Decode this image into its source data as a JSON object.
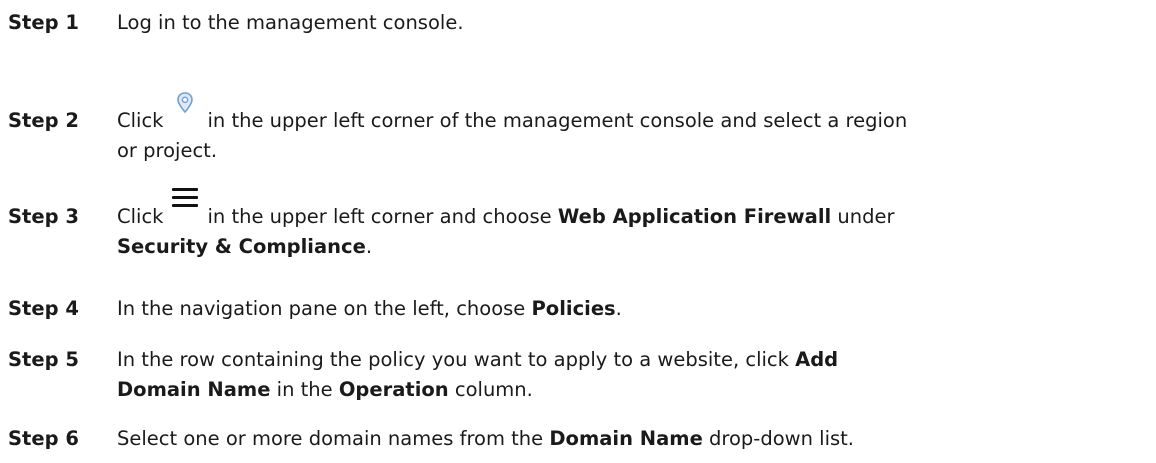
{
  "steps": [
    {
      "label": "Step 1",
      "parts": [
        "Log in to the management console."
      ]
    },
    {
      "label": "Step 2",
      "parts": [
        "Click",
        "in the upper left corner of the management console and select a region",
        "or project."
      ],
      "icon": "location-pin-icon"
    },
    {
      "label": "Step 3",
      "parts": [
        "Click",
        "in the upper left corner and choose",
        "Web Application Firewall",
        "under",
        "Security & Compliance",
        "."
      ],
      "icon": "hamburger-menu-icon"
    },
    {
      "label": "Step 4",
      "parts": [
        "In the navigation pane on the left, choose",
        "Policies",
        "."
      ]
    },
    {
      "label": "Step 5",
      "parts": [
        "In the row containing the policy you want to apply to a website, click",
        "Add",
        "Domain Name",
        "in the",
        "Operation",
        "column."
      ]
    },
    {
      "label": "Step 6",
      "parts": [
        "Select one or more domain names from the",
        "Domain Name",
        "drop-down list."
      ]
    }
  ],
  "colors": {
    "text": "#1a1a1a",
    "pin_icon": "#6f9fd6",
    "pin_icon_fill": "#dfe9f6"
  }
}
